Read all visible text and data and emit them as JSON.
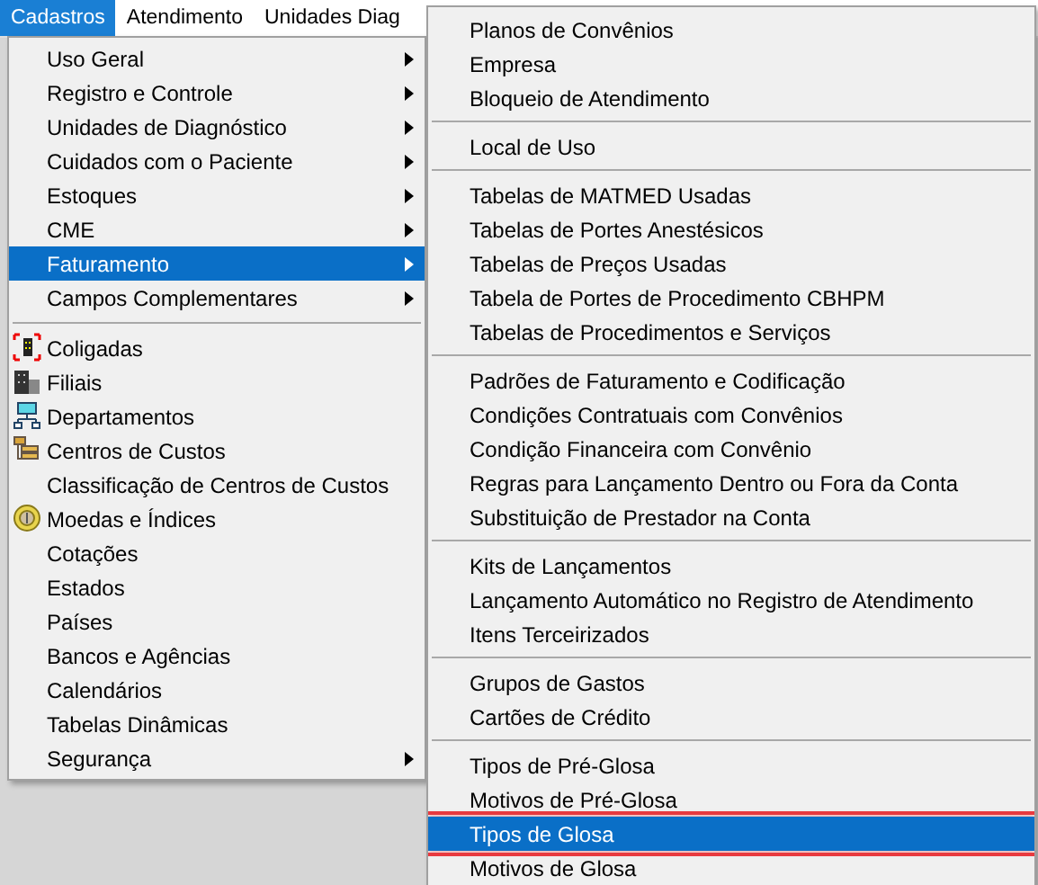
{
  "menubar": [
    {
      "label": "Cadastros",
      "selected": true
    },
    {
      "label": "Atendimento",
      "selected": false
    },
    {
      "label": "Unidades Diag",
      "selected": false
    }
  ],
  "menu": {
    "items": [
      {
        "kind": "item",
        "label": "Uso Geral",
        "submenu": true,
        "selected": false
      },
      {
        "kind": "item",
        "label": "Registro e Controle",
        "submenu": true,
        "selected": false
      },
      {
        "kind": "item",
        "label": "Unidades de Diagnóstico",
        "submenu": true,
        "selected": false
      },
      {
        "kind": "item",
        "label": "Cuidados com o Paciente",
        "submenu": true,
        "selected": false
      },
      {
        "kind": "item",
        "label": "Estoques",
        "submenu": true,
        "selected": false
      },
      {
        "kind": "item",
        "label": "CME",
        "submenu": true,
        "selected": false
      },
      {
        "kind": "item",
        "label": "Faturamento",
        "submenu": true,
        "selected": true
      },
      {
        "kind": "item",
        "label": "Campos Complementares",
        "submenu": true,
        "selected": false
      },
      {
        "kind": "separator"
      },
      {
        "kind": "item",
        "label": "Coligadas",
        "has_icon": true,
        "selected": false
      },
      {
        "kind": "item",
        "label": "Filiais",
        "has_icon": true,
        "selected": false
      },
      {
        "kind": "item",
        "label": "Departamentos",
        "has_icon": true,
        "selected": false
      },
      {
        "kind": "item",
        "label": "Centros de Custos",
        "has_icon": true,
        "selected": false
      },
      {
        "kind": "item",
        "label": "Classificação de Centros de Custos",
        "selected": false
      },
      {
        "kind": "item",
        "label": "Moedas e Índices",
        "has_icon": true,
        "selected": false
      },
      {
        "kind": "item",
        "label": "Cotações",
        "selected": false
      },
      {
        "kind": "item",
        "label": "Estados",
        "selected": false
      },
      {
        "kind": "item",
        "label": "Países",
        "selected": false
      },
      {
        "kind": "item",
        "label": "Bancos e Agências",
        "selected": false
      },
      {
        "kind": "item",
        "label": "Calendários",
        "selected": false
      },
      {
        "kind": "item",
        "label": "Tabelas Dinâmicas",
        "selected": false
      },
      {
        "kind": "item",
        "label": "Segurança",
        "submenu": true,
        "selected": false
      }
    ]
  },
  "submenu": {
    "items": [
      {
        "kind": "item",
        "label": "Planos de Convênios",
        "selected": false
      },
      {
        "kind": "item",
        "label": "Empresa",
        "selected": false
      },
      {
        "kind": "item",
        "label": "Bloqueio de Atendimento",
        "selected": false
      },
      {
        "kind": "separator"
      },
      {
        "kind": "item",
        "label": "Local de Uso",
        "selected": false
      },
      {
        "kind": "separator"
      },
      {
        "kind": "item",
        "label": "Tabelas de MATMED Usadas",
        "selected": false
      },
      {
        "kind": "item",
        "label": "Tabelas de Portes Anestésicos",
        "selected": false
      },
      {
        "kind": "item",
        "label": "Tabelas de Preços Usadas",
        "selected": false
      },
      {
        "kind": "item",
        "label": "Tabela de Portes de Procedimento CBHPM",
        "selected": false
      },
      {
        "kind": "item",
        "label": "Tabelas de Procedimentos e Serviços",
        "selected": false
      },
      {
        "kind": "separator"
      },
      {
        "kind": "item",
        "label": "Padrões de Faturamento e Codificação",
        "selected": false
      },
      {
        "kind": "item",
        "label": "Condições Contratuais com Convênios",
        "selected": false
      },
      {
        "kind": "item",
        "label": "Condição Financeira com Convênio",
        "selected": false
      },
      {
        "kind": "item",
        "label": "Regras para Lançamento Dentro ou Fora da Conta",
        "selected": false
      },
      {
        "kind": "item",
        "label": "Substituição de Prestador na Conta",
        "selected": false
      },
      {
        "kind": "separator"
      },
      {
        "kind": "item",
        "label": "Kits de Lançamentos",
        "selected": false
      },
      {
        "kind": "item",
        "label": "Lançamento Automático no Registro de Atendimento",
        "selected": false
      },
      {
        "kind": "item",
        "label": "Itens Terceirizados",
        "selected": false
      },
      {
        "kind": "separator"
      },
      {
        "kind": "item",
        "label": "Grupos de Gastos",
        "selected": false
      },
      {
        "kind": "item",
        "label": "Cartões de Crédito",
        "selected": false
      },
      {
        "kind": "separator"
      },
      {
        "kind": "item",
        "label": "Tipos de Pré-Glosa",
        "selected": false
      },
      {
        "kind": "item",
        "label": "Motivos de Pré-Glosa",
        "selected": false
      },
      {
        "kind": "item",
        "label": "Tipos de Glosa",
        "selected": true,
        "outlined": true
      },
      {
        "kind": "item",
        "label": "Motivos de Glosa",
        "selected": false
      }
    ]
  }
}
